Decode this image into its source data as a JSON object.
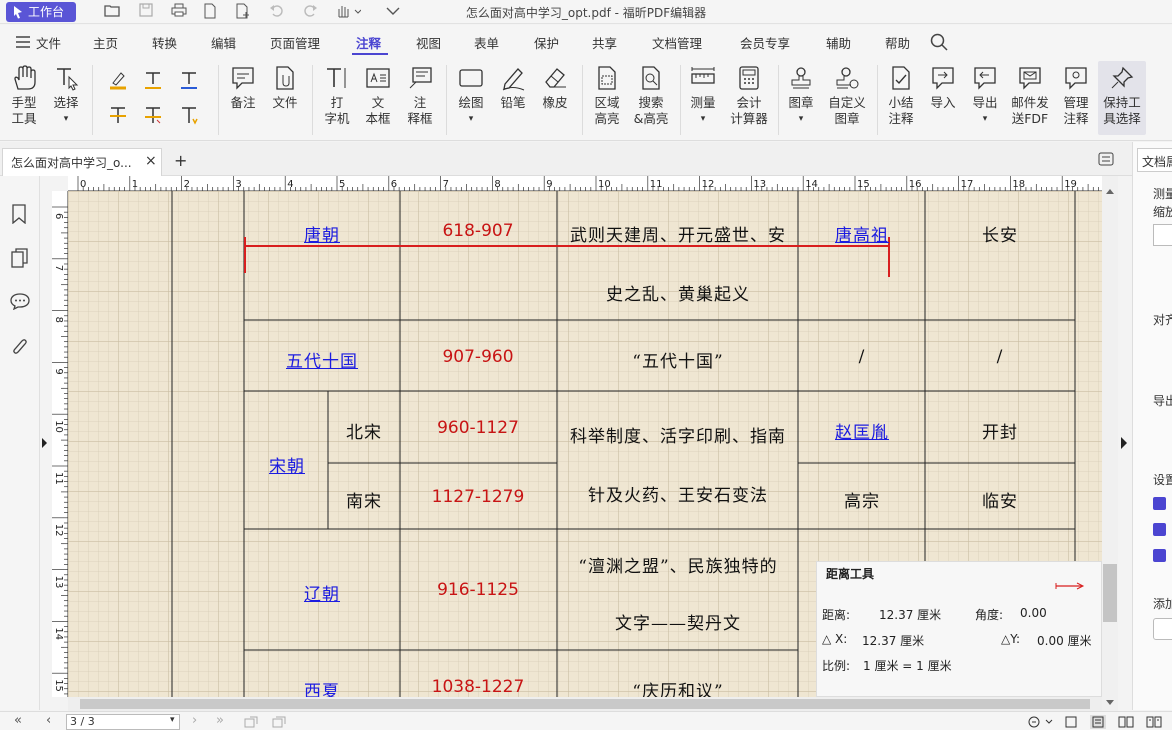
{
  "titlebar": {
    "workbench_label": "工作台",
    "window_title": "怎么面对高中学习_opt.pdf - 福昕PDF编辑器"
  },
  "menu": {
    "file": "文件",
    "items": [
      "主页",
      "转换",
      "编辑",
      "页面管理",
      "注释",
      "视图",
      "表单",
      "保护",
      "共享",
      "文档管理",
      "会员专享",
      "辅助",
      "帮助"
    ],
    "active": "注释"
  },
  "toolbar": {
    "hand": [
      "手型",
      "工具"
    ],
    "select": "选择",
    "note": "备注",
    "file": "文件",
    "typewriter": [
      "打",
      "字机"
    ],
    "textbox": [
      "文",
      "本框"
    ],
    "callout": [
      "注",
      "释框"
    ],
    "draw": "绘图",
    "pencil": "铅笔",
    "eraser": "橡皮",
    "area_highlight": [
      "区域",
      "高亮"
    ],
    "search_highlight": [
      "搜索",
      "&高亮"
    ],
    "measure": "测量",
    "calculator": [
      "会计",
      "计算器"
    ],
    "stamp": "图章",
    "custom_stamp": [
      "自定义",
      "图章"
    ],
    "summary": [
      "小结",
      "注释"
    ],
    "import": "导入",
    "export": "导出",
    "email": [
      "邮件发",
      "送FDF"
    ],
    "manage": [
      "管理",
      "注释"
    ],
    "keep_tool": [
      "保持工",
      "具选择"
    ]
  },
  "tabs": {
    "doc_tab": "怎么面对高中学习_o...",
    "close": "×",
    "add": "+"
  },
  "ruler": {
    "top": [
      "0",
      "1",
      "2",
      "3",
      "4",
      "5",
      "6",
      "7",
      "8",
      "9",
      "10",
      "11",
      "12",
      "13",
      "14",
      "15",
      "16",
      "17",
      "18",
      "19"
    ],
    "left": [
      "6",
      "7",
      "8",
      "9",
      "10",
      "11",
      "12",
      "13",
      "14",
      "15"
    ]
  },
  "table": {
    "tang": {
      "name": "唐朝",
      "years": "618-907",
      "events1": "武则天建周、开元盛世、安",
      "events2": "史之乱、黄巢起义",
      "founder": "唐高祖",
      "capital": "长安"
    },
    "wudai": {
      "name": "五代十国",
      "years": "907-960",
      "events": "“五代十国”",
      "founder": "/",
      "capital": "/"
    },
    "song": {
      "name": "宋朝",
      "north": "北宋",
      "north_years": "960-1127",
      "south": "南宋",
      "south_years": "1127-1279",
      "events1": "科举制度、活字印刷、指南",
      "events2": "针及火药、王安石变法",
      "north_founder": "赵匡胤",
      "north_capital": "开封",
      "south_founder": "高宗",
      "south_capital": "临安"
    },
    "liao": {
      "name": "辽朝",
      "years": "916-1125",
      "events1": "“澶渊之盟”、民族独特的",
      "events2": "文字——契丹文"
    },
    "xixia": {
      "name": "西夏",
      "years": "1038-1227",
      "events": "“庆历和议”"
    }
  },
  "measure_panel": {
    "title": "距离工具",
    "distance_label": "距离:",
    "distance_value": "12.37 厘米",
    "angle_label": "角度:",
    "angle_value": "0.00",
    "dx_label": "△ X:",
    "dx_value": "12.37 厘米",
    "dy_label": "△Y:",
    "dy_value": "0.00 厘米",
    "scale_label": "比例:",
    "scale_value": "1 厘米 = 1 厘米"
  },
  "right_panel": {
    "tab": "文档属",
    "measure": "测量",
    "zoom": "缩放",
    "align": "对齐",
    "export": "导出",
    "settings": "设置",
    "add": "添加"
  },
  "status": {
    "page": "3 / 3"
  },
  "colors": {
    "accent": "#4b45d1",
    "measure_line": "#d81e1e",
    "link": "#1c1ce0",
    "years": "#c81414"
  }
}
